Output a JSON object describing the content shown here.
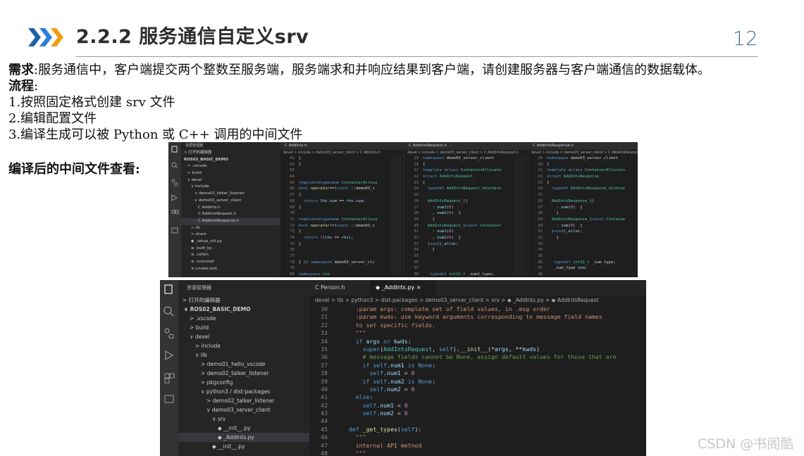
{
  "header": {
    "title": "2.2.2 服务通信自定义srv",
    "page_number": "12",
    "accent_color": "#2d7fd8"
  },
  "body": {
    "req_label": "需求",
    "req_text": ":服务通信中，客户端提交两个整数至服务端，服务端求和并响应结果到客户端，请创建服务器与客户端通信的数据载体。",
    "flow_label": "流程",
    "flow_colon": ":",
    "steps": [
      "1.按照固定格式创建 srv 文件",
      "2.编辑配置文件",
      "3.编译生成可以被 Python 或 C++ 调用的中间文件"
    ],
    "compiled_label": "编译后的中间文件查看:"
  },
  "watermark": "CSDN @书阁酷",
  "top_shot": {
    "explorer_title": "资源管理器",
    "open_editors": "打开的编辑器",
    "tree": [
      {
        "label": "ROS02_BASIC_DEMO",
        "depth": 0
      },
      {
        "label": "> .vscode",
        "depth": 1
      },
      {
        "label": "> build",
        "depth": 1
      },
      {
        "label": "∨ devel",
        "depth": 1
      },
      {
        "label": "∨ include",
        "depth": 2
      },
      {
        "label": "> demo02_talker_listener",
        "depth": 3
      },
      {
        "label": "∨ demo03_server_client",
        "depth": 3
      },
      {
        "label": "C  AddInts.h",
        "depth": 4
      },
      {
        "label": "C  AddIntsRequest.h",
        "depth": 4
      },
      {
        "label": "C  AddIntsResponse.h",
        "depth": 4,
        "selected": true
      },
      {
        "label": "> lib",
        "depth": 2
      },
      {
        "label": "> share",
        "depth": 2
      },
      {
        "label": "◆ _setup_util.py",
        "depth": 2
      },
      {
        "label": "≡ .built_by",
        "depth": 2
      },
      {
        "label": "≡ .catkin",
        "depth": 2
      },
      {
        "label": "≡ .rosinstall",
        "depth": 2
      },
      {
        "label": "≡ cmake.lock",
        "depth": 2
      }
    ],
    "pane1": {
      "tab": "C  AddInts.h",
      "crumb": "devel > include > demo03_server_client > C  AddInts.h",
      "lines": [
        [
          "61",
          "}"
        ],
        [
          "62",
          "}"
        ],
        [
          "63",
          ""
        ],
        [
          "64",
          ""
        ],
        [
          "65",
          "template<typename ContainerAlloca"
        ],
        [
          "66",
          "bool operator==(const ::demo03_s"
        ],
        [
          "67",
          "{"
        ],
        [
          "68",
          "  return lhs.sum == rhs.sum;"
        ],
        [
          "69",
          "}"
        ],
        [
          "70",
          ""
        ],
        [
          "71",
          "template<typename ContainerAlloca"
        ],
        [
          "72",
          "bool operator!=(const ::demo03_s"
        ],
        [
          "73",
          "{"
        ],
        [
          "74",
          "  return !(lhs == rhs);"
        ],
        [
          "75",
          "}"
        ],
        [
          "76",
          ""
        ],
        [
          "77",
          ""
        ],
        [
          "78",
          "} // namespace demo03_server_cli"
        ],
        [
          "79",
          ""
        ],
        [
          "80",
          "namespace ros"
        ]
      ]
    },
    "pane2": {
      "tab": "C  AddIntsRequest.h",
      "crumb": "devel > include > demo03_server_client > C  AddIntsRequest.h",
      "lines": [
        [
          "19",
          "namespace demo03_server_client"
        ],
        [
          "20",
          "{"
        ],
        [
          "21",
          "template <class ContainerAllocato"
        ],
        [
          "22",
          "struct AddIntsRequest_"
        ],
        [
          "23",
          "{"
        ],
        [
          "24",
          "  typedef AddIntsRequest_<Contain"
        ],
        [
          "25",
          ""
        ],
        [
          "26",
          "  AddIntsRequest_()"
        ],
        [
          "27",
          "    : num1(0)"
        ],
        [
          "28",
          "    , num2(0)  {"
        ],
        [
          "29",
          "    }"
        ],
        [
          "30",
          "  AddIntsRequest_(const Container"
        ],
        [
          "31",
          "    : num1(0)"
        ],
        [
          "32",
          "    , num2(0)  {"
        ],
        [
          "33",
          "  (void)_alloc;"
        ],
        [
          "34",
          "    }"
        ],
        [
          "35",
          ""
        ],
        [
          "36",
          ""
        ],
        [
          "37",
          ""
        ],
        [
          "38",
          "   typedef int32_t _num1_type;"
        ]
      ]
    },
    "pane3": {
      "tab": "C  AddIntsResponse.h",
      "crumb": "devel > include > demo03_server_client > C  AddIntsResponse.h",
      "lines": [
        [
          "19",
          "namespace demo03_server_client"
        ],
        [
          "20",
          "{"
        ],
        [
          "21",
          "template <class ContainerAllocato"
        ],
        [
          "22",
          "struct AddIntsResponse_"
        ],
        [
          "23",
          "{"
        ],
        [
          "24",
          "  typedef AddIntsResponse_<Contai"
        ],
        [
          "25",
          ""
        ],
        [
          "26",
          "  AddIntsResponse_()"
        ],
        [
          "27",
          "    : sum(0)  {"
        ],
        [
          "28",
          "    }"
        ],
        [
          "29",
          "  AddIntsResponse_(const Containe"
        ],
        [
          "30",
          "    : sum(0)  {"
        ],
        [
          "31",
          "  (void)_alloc;"
        ],
        [
          "32",
          "    }"
        ],
        [
          "33",
          ""
        ],
        [
          "34",
          ""
        ],
        [
          "35",
          ""
        ],
        [
          "36",
          "   typedef int32_t _sum_type;"
        ],
        [
          "37",
          "   _sum_type sum;"
        ],
        [
          "38",
          ""
        ]
      ]
    }
  },
  "bottom_shot": {
    "explorer_title": "资源管理器",
    "open_editors": "打开的编辑器",
    "tree": [
      {
        "label": "∨ ROS02_BASIC_DEMO",
        "depth": 0
      },
      {
        "label": "> .vscode",
        "depth": 1
      },
      {
        "label": "> build",
        "depth": 1
      },
      {
        "label": "∨ devel",
        "depth": 1
      },
      {
        "label": "> include",
        "depth": 2
      },
      {
        "label": "∨ lib",
        "depth": 2
      },
      {
        "label": "> demo01_hello_vscode",
        "depth": 3
      },
      {
        "label": "> demo02_talker_listener",
        "depth": 3
      },
      {
        "label": "> pkgconfig",
        "depth": 3
      },
      {
        "label": "∨ python3 / dist-packages",
        "depth": 3
      },
      {
        "label": "> demo02_talker_listener",
        "depth": 4
      },
      {
        "label": "∨ demo03_server_client",
        "depth": 4
      },
      {
        "label": "∨ srv",
        "depth": 5
      },
      {
        "label": "◆ __init__.py",
        "depth": 6
      },
      {
        "label": "◆ _AddInts.py",
        "depth": 6,
        "selected": true
      },
      {
        "label": "◆ __init__.py",
        "depth": 5
      }
    ],
    "tabs": [
      {
        "label": "C  Person.h",
        "active": false
      },
      {
        "label": "◆ _AddInts.py  ×",
        "active": true
      }
    ],
    "crumb": "devel > lib > python3 > dist-packages > demo03_server_client > srv > ◆ _AddInts.py > ◆ AddIntsRequest",
    "lines": [
      [
        "30",
        "    :param args: complete set of field values, in .msg order"
      ],
      [
        "31",
        "    :param kwds: use keyword arguments corresponding to message field names"
      ],
      [
        "32",
        "    to set specific fields."
      ],
      [
        "33",
        "    \"\"\""
      ],
      [
        "34",
        "    if args or kwds:"
      ],
      [
        "35",
        "      super(AddIntsRequest, self).__init__(*args, **kwds)"
      ],
      [
        "36",
        "      # message fields cannot be None, assign default values for those that are"
      ],
      [
        "37",
        "      if self.num1 is None:"
      ],
      [
        "38",
        "        self.num1 = 0"
      ],
      [
        "39",
        "      if self.num2 is None:"
      ],
      [
        "40",
        "        self.num2 = 0"
      ],
      [
        "41",
        "    else:"
      ],
      [
        "42",
        "      self.num1 = 0"
      ],
      [
        "43",
        "      self.num2 = 0"
      ],
      [
        "44",
        ""
      ],
      [
        "45",
        "  def _get_types(self):"
      ],
      [
        "46",
        "    \"\"\""
      ],
      [
        "47",
        "    internal API method"
      ],
      [
        "48",
        "    \"\"\""
      ]
    ]
  }
}
